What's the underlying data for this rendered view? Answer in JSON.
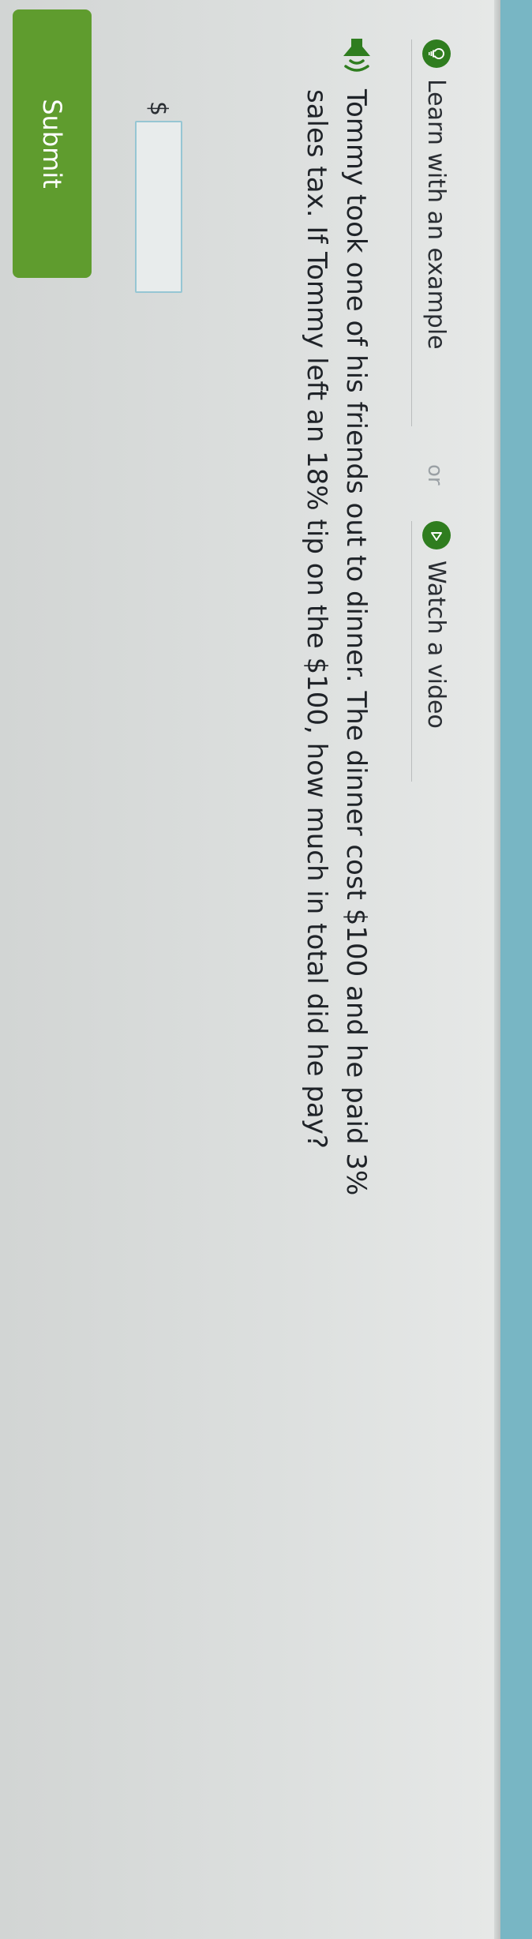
{
  "links": {
    "learn_label": "Learn with an example",
    "separator": "or",
    "video_label": "Watch a video"
  },
  "icons": {
    "learn": "lightbulb-icon",
    "video": "play-icon",
    "speaker": "speaker-icon"
  },
  "question": {
    "text": "Tommy took one of his friends out to dinner. The dinner cost $100 and he paid 3% sales tax. If Tommy left an 18% tip on the $100, how much in total did he pay?"
  },
  "answer": {
    "currency": "$",
    "value": ""
  },
  "submit": {
    "label": "Submit"
  },
  "colors": {
    "accent_green": "#5f9c2e",
    "icon_green": "#2f7d1f",
    "input_border": "#96c6d3",
    "top_strip": "#78b6c4"
  }
}
